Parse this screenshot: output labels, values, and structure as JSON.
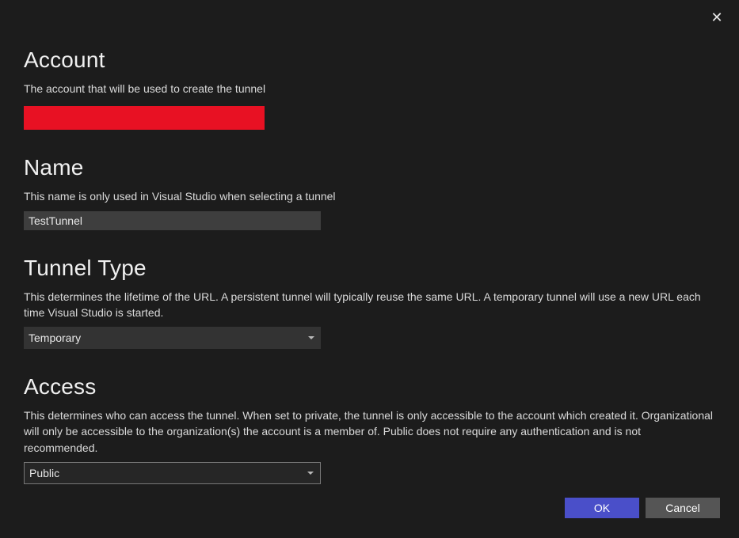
{
  "close": "✕",
  "sections": {
    "account": {
      "title": "Account",
      "desc": "The account that will be used to create the tunnel",
      "value": ""
    },
    "name": {
      "title": "Name",
      "desc": "This name is only used in Visual Studio when selecting a tunnel",
      "value": "TestTunnel"
    },
    "tunnelType": {
      "title": "Tunnel Type",
      "desc": "This determines the lifetime of the URL. A persistent tunnel will typically reuse the same URL. A temporary tunnel will use a new URL each time Visual Studio is started.",
      "value": "Temporary"
    },
    "access": {
      "title": "Access",
      "desc": "This determines who can access the tunnel. When set to private, the tunnel is only accessible to the account which created it. Organizational will only be accessible to the organization(s) the account is a member of. Public does not require any authentication and is not recommended.",
      "value": "Public"
    }
  },
  "buttons": {
    "ok": "OK",
    "cancel": "Cancel"
  }
}
